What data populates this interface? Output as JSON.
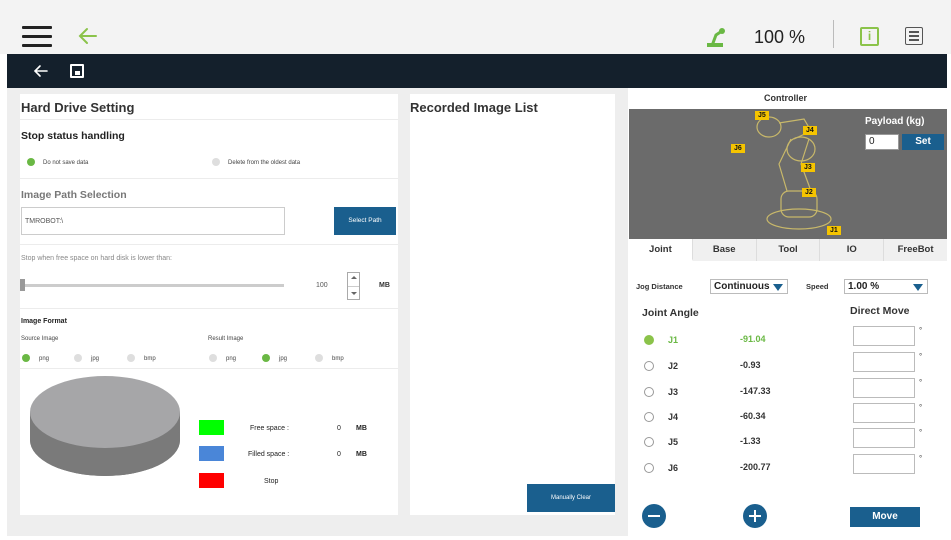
{
  "topbar": {
    "speed": "100 %",
    "info_glyph": "i"
  },
  "hard_drive": {
    "title": "Hard Drive Setting",
    "stop_status": {
      "heading": "Stop status handling",
      "options": [
        {
          "label": "Do not save data",
          "selected": true
        },
        {
          "label": "Delete from the oldest data",
          "selected": false
        }
      ]
    },
    "image_path": {
      "heading": "Image Path Selection",
      "value": "TMROBOT:\\",
      "button": "Select Path"
    },
    "free_space": {
      "label": "Stop when free space on hard disk is lower than:",
      "value": "100",
      "unit": "MB",
      "slider_fraction": 0.0
    },
    "image_format": {
      "heading": "Image Format",
      "source_label": "Source Image",
      "result_label": "Result Image",
      "source_options": [
        {
          "label": "png",
          "selected": true
        },
        {
          "label": "jpg",
          "selected": false
        },
        {
          "label": "bmp",
          "selected": false
        }
      ],
      "result_options": [
        {
          "label": "png",
          "selected": false
        },
        {
          "label": "jpg",
          "selected": true
        },
        {
          "label": "bmp",
          "selected": false
        }
      ]
    },
    "legend": [
      {
        "label": "Free space :",
        "value": "0",
        "unit": "MB",
        "color": "#00ff00"
      },
      {
        "label": "Filled space :",
        "value": "0",
        "unit": "MB",
        "color": "#4a86d8"
      },
      {
        "label": "Stop",
        "value": "",
        "unit": "",
        "color": "#ff0000"
      }
    ]
  },
  "recorded_images": {
    "title": "Recorded Image List",
    "button": "Manually Clear"
  },
  "controller": {
    "title": "Controller",
    "payload_label": "Payload (kg)",
    "payload_value": "0",
    "set_button": "Set",
    "joint_tags": [
      "J5",
      "J4",
      "J6",
      "J3",
      "J2",
      "J1"
    ],
    "tabs": [
      "Joint",
      "Base",
      "Tool",
      "IO",
      "FreeBot"
    ],
    "active_tab": "Joint",
    "jog_distance_label": "Jog Distance",
    "jog_distance_value": "Continuous",
    "speed_label": "Speed",
    "speed_value": "1.00 %",
    "joint_angle_heading": "Joint Angle",
    "direct_move_heading": "Direct Move",
    "degree_symbol": "°",
    "joints": [
      {
        "name": "J1",
        "value": "-91.04",
        "selected": true
      },
      {
        "name": "J2",
        "value": "-0.93",
        "selected": false
      },
      {
        "name": "J3",
        "value": "-147.33",
        "selected": false
      },
      {
        "name": "J4",
        "value": "-60.34",
        "selected": false
      },
      {
        "name": "J5",
        "value": "-1.33",
        "selected": false
      },
      {
        "name": "J6",
        "value": "-200.77",
        "selected": false
      }
    ],
    "move_button": "Move"
  }
}
